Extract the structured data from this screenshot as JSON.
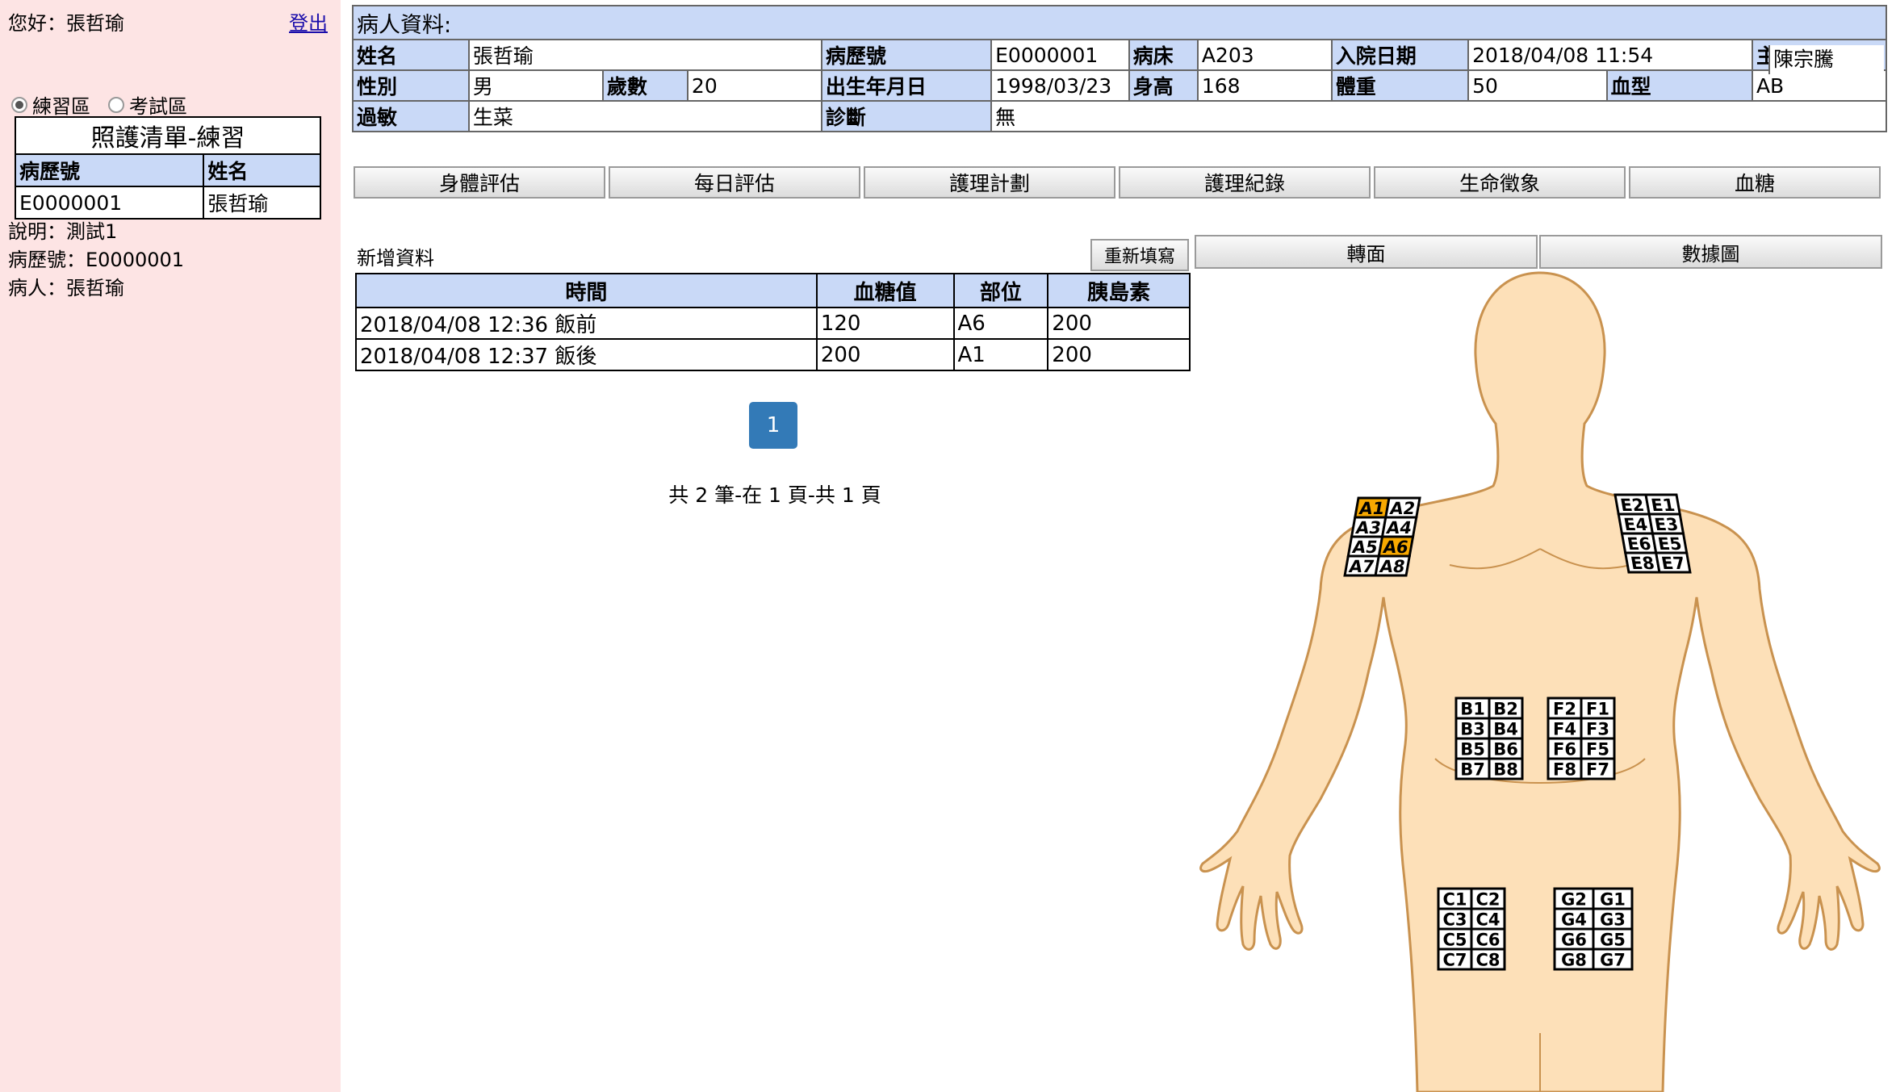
{
  "sidebar": {
    "greeting": "您好：張哲瑜",
    "logout": "登出",
    "radio_practice": "練習區",
    "radio_exam": "考試區",
    "list_title": "照護清單-練習",
    "col_record_no": "病歷號",
    "col_name": "姓名",
    "rows": [
      {
        "record_no": "E0000001",
        "name": "張哲瑜"
      }
    ],
    "note_line1": "說明：測試1",
    "note_line2": "病歷號：E0000001",
    "note_line3": "病人：張哲瑜"
  },
  "patient": {
    "header": "病人資料:",
    "name_label": "姓名",
    "name": "張哲瑜",
    "record_label": "病歷號",
    "record_no": "E0000001",
    "bed_label": "病床",
    "bed": "A203",
    "admit_label": "入院日期",
    "admit_date": "2018/04/08 11:54",
    "doctor_label": "主治醫生",
    "doctor": "陳宗騰",
    "sex_label": "性別",
    "sex": "男",
    "age_label": "歲數",
    "age": "20",
    "dob_label": "出生年月日",
    "dob": "1998/03/23",
    "height_label": "身高",
    "height": "168",
    "weight_label": "體重",
    "weight": "50",
    "blood_label": "血型",
    "blood_type": "AB",
    "allergy_label": "過敏",
    "allergy": "生菜",
    "diagnosis_label": "診斷",
    "diagnosis": "無"
  },
  "tabs": [
    "身體評估",
    "每日評估",
    "護理計劃",
    "護理紀錄",
    "生命徵象",
    "血糖"
  ],
  "form": {
    "add_label": "新增資料",
    "reset_button": "重新填寫",
    "flip_button": "轉面",
    "chart_button": "數據圖"
  },
  "records": {
    "headers": [
      "時間",
      "血糖值",
      "部位",
      "胰島素"
    ],
    "rows": [
      {
        "time": "2018/04/08 12:36 飯前",
        "glucose": "120",
        "site": "A6",
        "insulin": "200"
      },
      {
        "time": "2018/04/08 12:37 飯後",
        "glucose": "200",
        "site": "A1",
        "insulin": "200"
      }
    ]
  },
  "pagination": {
    "page": "1",
    "info": "共 2 筆-在 1 頁-共 1 頁"
  },
  "injection_map": {
    "highlighted_sites": [
      "A1",
      "A6"
    ],
    "highlight_color": "#f7a800",
    "skin_color": "#fde0b8",
    "outline_color": "#c9924f",
    "grids": [
      {
        "id": "A",
        "labels": [
          "A1",
          "A2",
          "A3",
          "A4",
          "A5",
          "A6",
          "A7",
          "A8"
        ]
      },
      {
        "id": "E",
        "labels": [
          "E2",
          "E1",
          "E4",
          "E3",
          "E6",
          "E5",
          "E8",
          "E7"
        ]
      },
      {
        "id": "B",
        "labels": [
          "B1",
          "B2",
          "B3",
          "B4",
          "B5",
          "B6",
          "B7",
          "B8"
        ]
      },
      {
        "id": "F",
        "labels": [
          "F2",
          "F1",
          "F4",
          "F3",
          "F6",
          "F5",
          "F8",
          "F7"
        ]
      },
      {
        "id": "C",
        "labels": [
          "C1",
          "C2",
          "C3",
          "C4",
          "C5",
          "C6",
          "C7",
          "C8"
        ]
      },
      {
        "id": "G",
        "labels": [
          "G2",
          "G1",
          "G4",
          "G3",
          "G6",
          "G5",
          "G8",
          "G7"
        ]
      }
    ]
  }
}
